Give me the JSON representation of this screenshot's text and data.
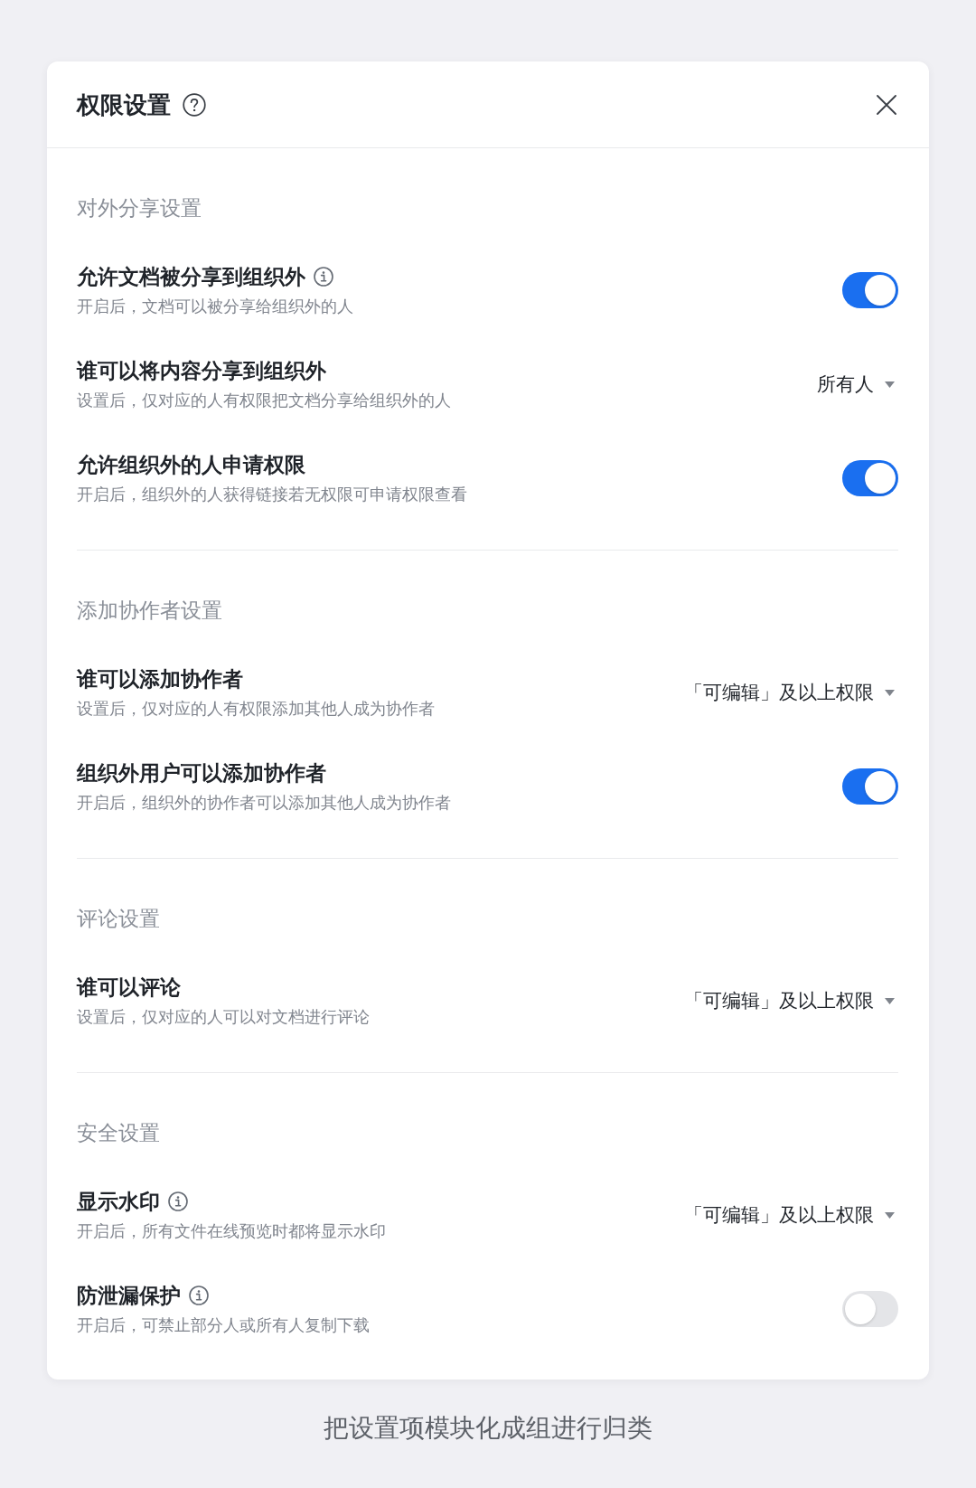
{
  "dialog": {
    "title": "权限设置",
    "help": true
  },
  "sections": [
    {
      "title": "对外分享设置",
      "items": [
        {
          "kind": "toggle",
          "title": "允许文档被分享到组织外",
          "info": true,
          "description": "开启后，文档可以被分享给组织外的人",
          "on": true
        },
        {
          "kind": "dropdown",
          "title": "谁可以将内容分享到组织外",
          "info": false,
          "description": "设置后，仅对应的人有权限把文档分享给组织外的人",
          "value": "所有人"
        },
        {
          "kind": "toggle",
          "title": "允许组织外的人申请权限",
          "info": false,
          "description": "开启后，组织外的人获得链接若无权限可申请权限查看",
          "on": true
        }
      ]
    },
    {
      "title": "添加协作者设置",
      "items": [
        {
          "kind": "dropdown",
          "title": "谁可以添加协作者",
          "info": false,
          "description": "设置后，仅对应的人有权限添加其他人成为协作者",
          "value": "「可编辑」及以上权限"
        },
        {
          "kind": "toggle",
          "title": "组织外用户可以添加协作者",
          "info": false,
          "description": "开启后，组织外的协作者可以添加其他人成为协作者",
          "on": true
        }
      ]
    },
    {
      "title": "评论设置",
      "items": [
        {
          "kind": "dropdown",
          "title": "谁可以评论",
          "info": false,
          "description": "设置后，仅对应的人可以对文档进行评论",
          "value": "「可编辑」及以上权限"
        }
      ]
    },
    {
      "title": "安全设置",
      "items": [
        {
          "kind": "dropdown",
          "title": "显示水印",
          "info": true,
          "description": "开启后，所有文件在线预览时都将显示水印",
          "value": "「可编辑」及以上权限"
        },
        {
          "kind": "toggle",
          "title": "防泄漏保护",
          "info": true,
          "description": "开启后，可禁止部分人或所有人复制下载",
          "on": false
        }
      ]
    }
  ],
  "caption": "把设置项模块化成组进行归类"
}
